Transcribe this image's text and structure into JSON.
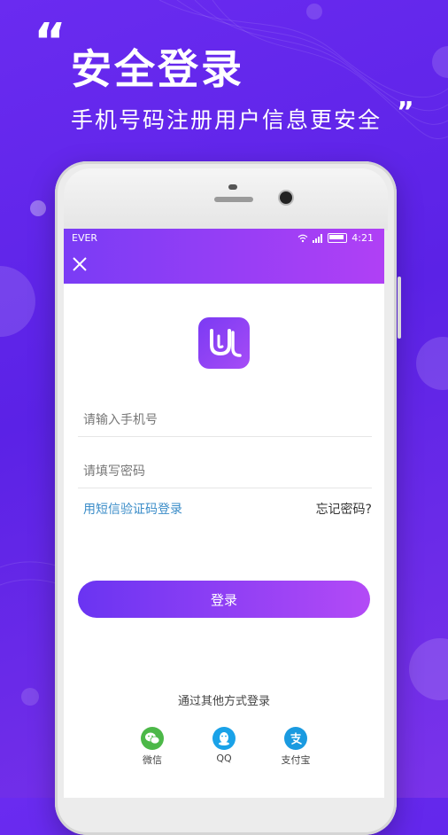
{
  "hero": {
    "quote_open": "“",
    "title": "安全登录",
    "subtitle": "手机号码注册用户信息更安全",
    "quote_close": "”"
  },
  "statusbar": {
    "carrier": "EVER",
    "time": "4:21"
  },
  "form": {
    "phone_placeholder": "请输入手机号",
    "password_placeholder": "请填写密码",
    "sms_login_label": "用短信验证码登录",
    "forgot_password_label": "忘记密码?",
    "login_button_label": "登录"
  },
  "social": {
    "heading": "通过其他方式登录",
    "items": [
      {
        "label": "微信",
        "icon": "wechat-icon",
        "color": "#4cb848"
      },
      {
        "label": "QQ",
        "icon": "qq-icon",
        "color": "#1aa2e8"
      },
      {
        "label": "支付宝",
        "icon": "alipay-icon",
        "color": "#1a9ae0"
      }
    ]
  },
  "colors": {
    "background": "#6a2bf0",
    "header_gradient_start": "#7a3cf5",
    "header_gradient_end": "#b040f5",
    "link": "#3a8cc8"
  }
}
